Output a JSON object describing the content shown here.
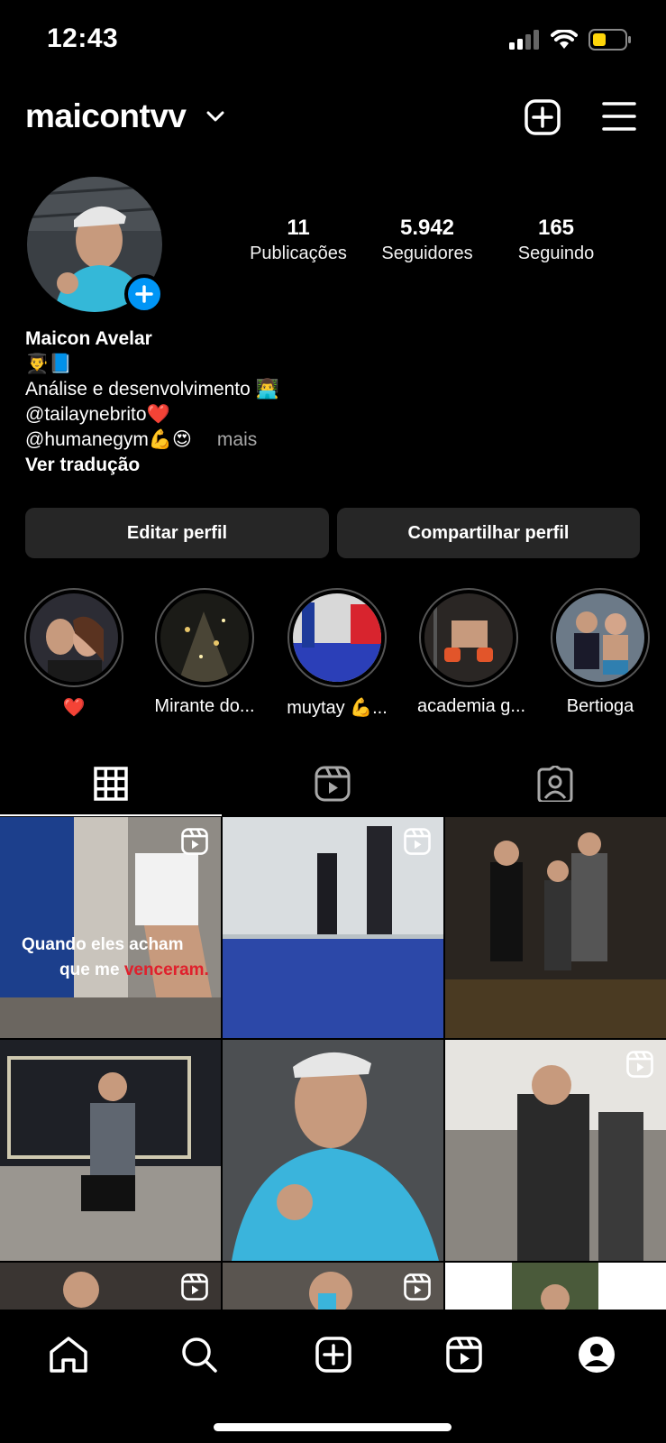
{
  "status_bar": {
    "time": "12:43",
    "battery_color": "#ffd60a"
  },
  "header": {
    "username": "maicontvv",
    "icons": [
      "chevron-down-icon",
      "add-post-icon",
      "menu-icon"
    ]
  },
  "profile": {
    "stats": [
      {
        "value": "11",
        "label": "Publicações"
      },
      {
        "value": "5.942",
        "label": "Seguidores"
      },
      {
        "value": "165",
        "label": "Seguindo"
      }
    ],
    "name": "Maicon Avelar",
    "bio_lines": [
      "👨‍🎓📘",
      "Análise e desenvolvimento 👨‍💻",
      "@tailaynebrito❤️",
      "@humanegym💪😍"
    ],
    "more": "mais",
    "translate": "Ver tradução"
  },
  "actions": {
    "edit": "Editar perfil",
    "share": "Compartilhar perfil"
  },
  "highlights": [
    {
      "label": "❤️"
    },
    {
      "label": "Mirante do..."
    },
    {
      "label": "muytay 💪..."
    },
    {
      "label": "academia g..."
    },
    {
      "label": "Bertioga"
    }
  ],
  "tabs": [
    "grid-icon",
    "reels-icon",
    "tagged-icon"
  ],
  "grid": {
    "post1_caption_line1": "Quando eles acham",
    "post1_caption_line2a": "que me ",
    "post1_caption_line2b": "venceram."
  },
  "colors": {
    "accent": "#0095f6",
    "button_bg": "#262626",
    "caption_red": "#e0202c"
  }
}
